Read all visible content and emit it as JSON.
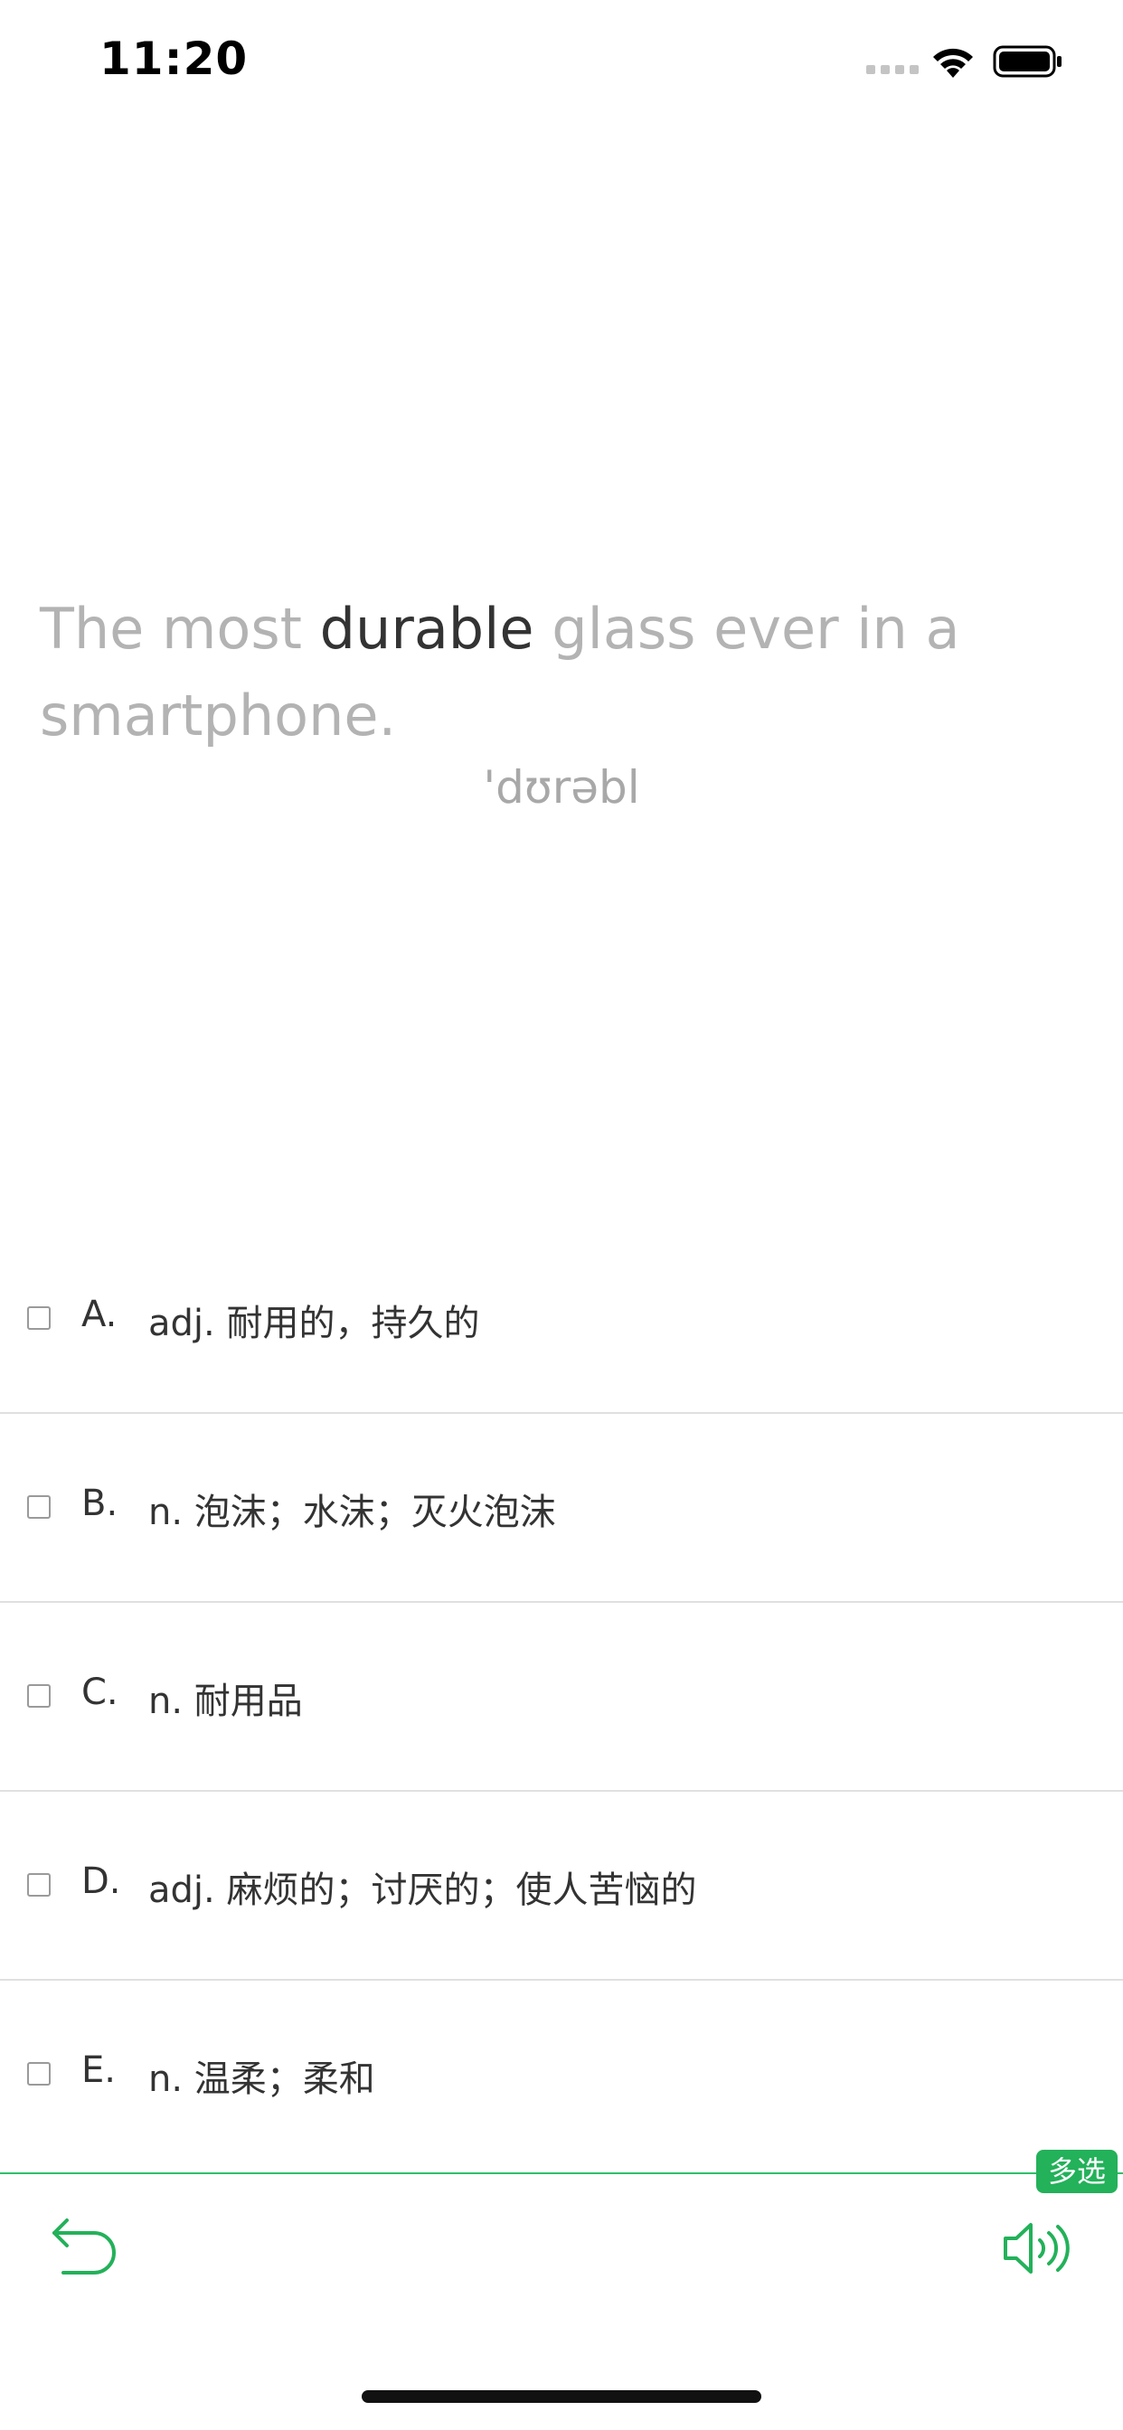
{
  "status_bar": {
    "time": "11:20"
  },
  "sentence": {
    "before": "The most ",
    "keyword": "durable",
    "after": " glass ever in a smartphone.",
    "phonetic": "'dʊrəbl"
  },
  "options": [
    {
      "letter": "A.",
      "text": "adj. 耐用的，持久的",
      "checked": false
    },
    {
      "letter": "B.",
      "text": "n. 泡沫；水沫；灭火泡沫",
      "checked": false
    },
    {
      "letter": "C.",
      "text": "n. 耐用品",
      "checked": false
    },
    {
      "letter": "D.",
      "text": "adj. 麻烦的；讨厌的；使人苦恼的",
      "checked": false
    },
    {
      "letter": "E.",
      "text": "n. 温柔；柔和",
      "checked": false
    }
  ],
  "toolbar": {
    "mode_badge": "多选",
    "back_icon": "undo-arrow-icon",
    "audio_icon": "speaker-icon"
  },
  "colors": {
    "accent": "#23b15a",
    "keyword": "#333333",
    "muted": "#b3b3b3"
  }
}
